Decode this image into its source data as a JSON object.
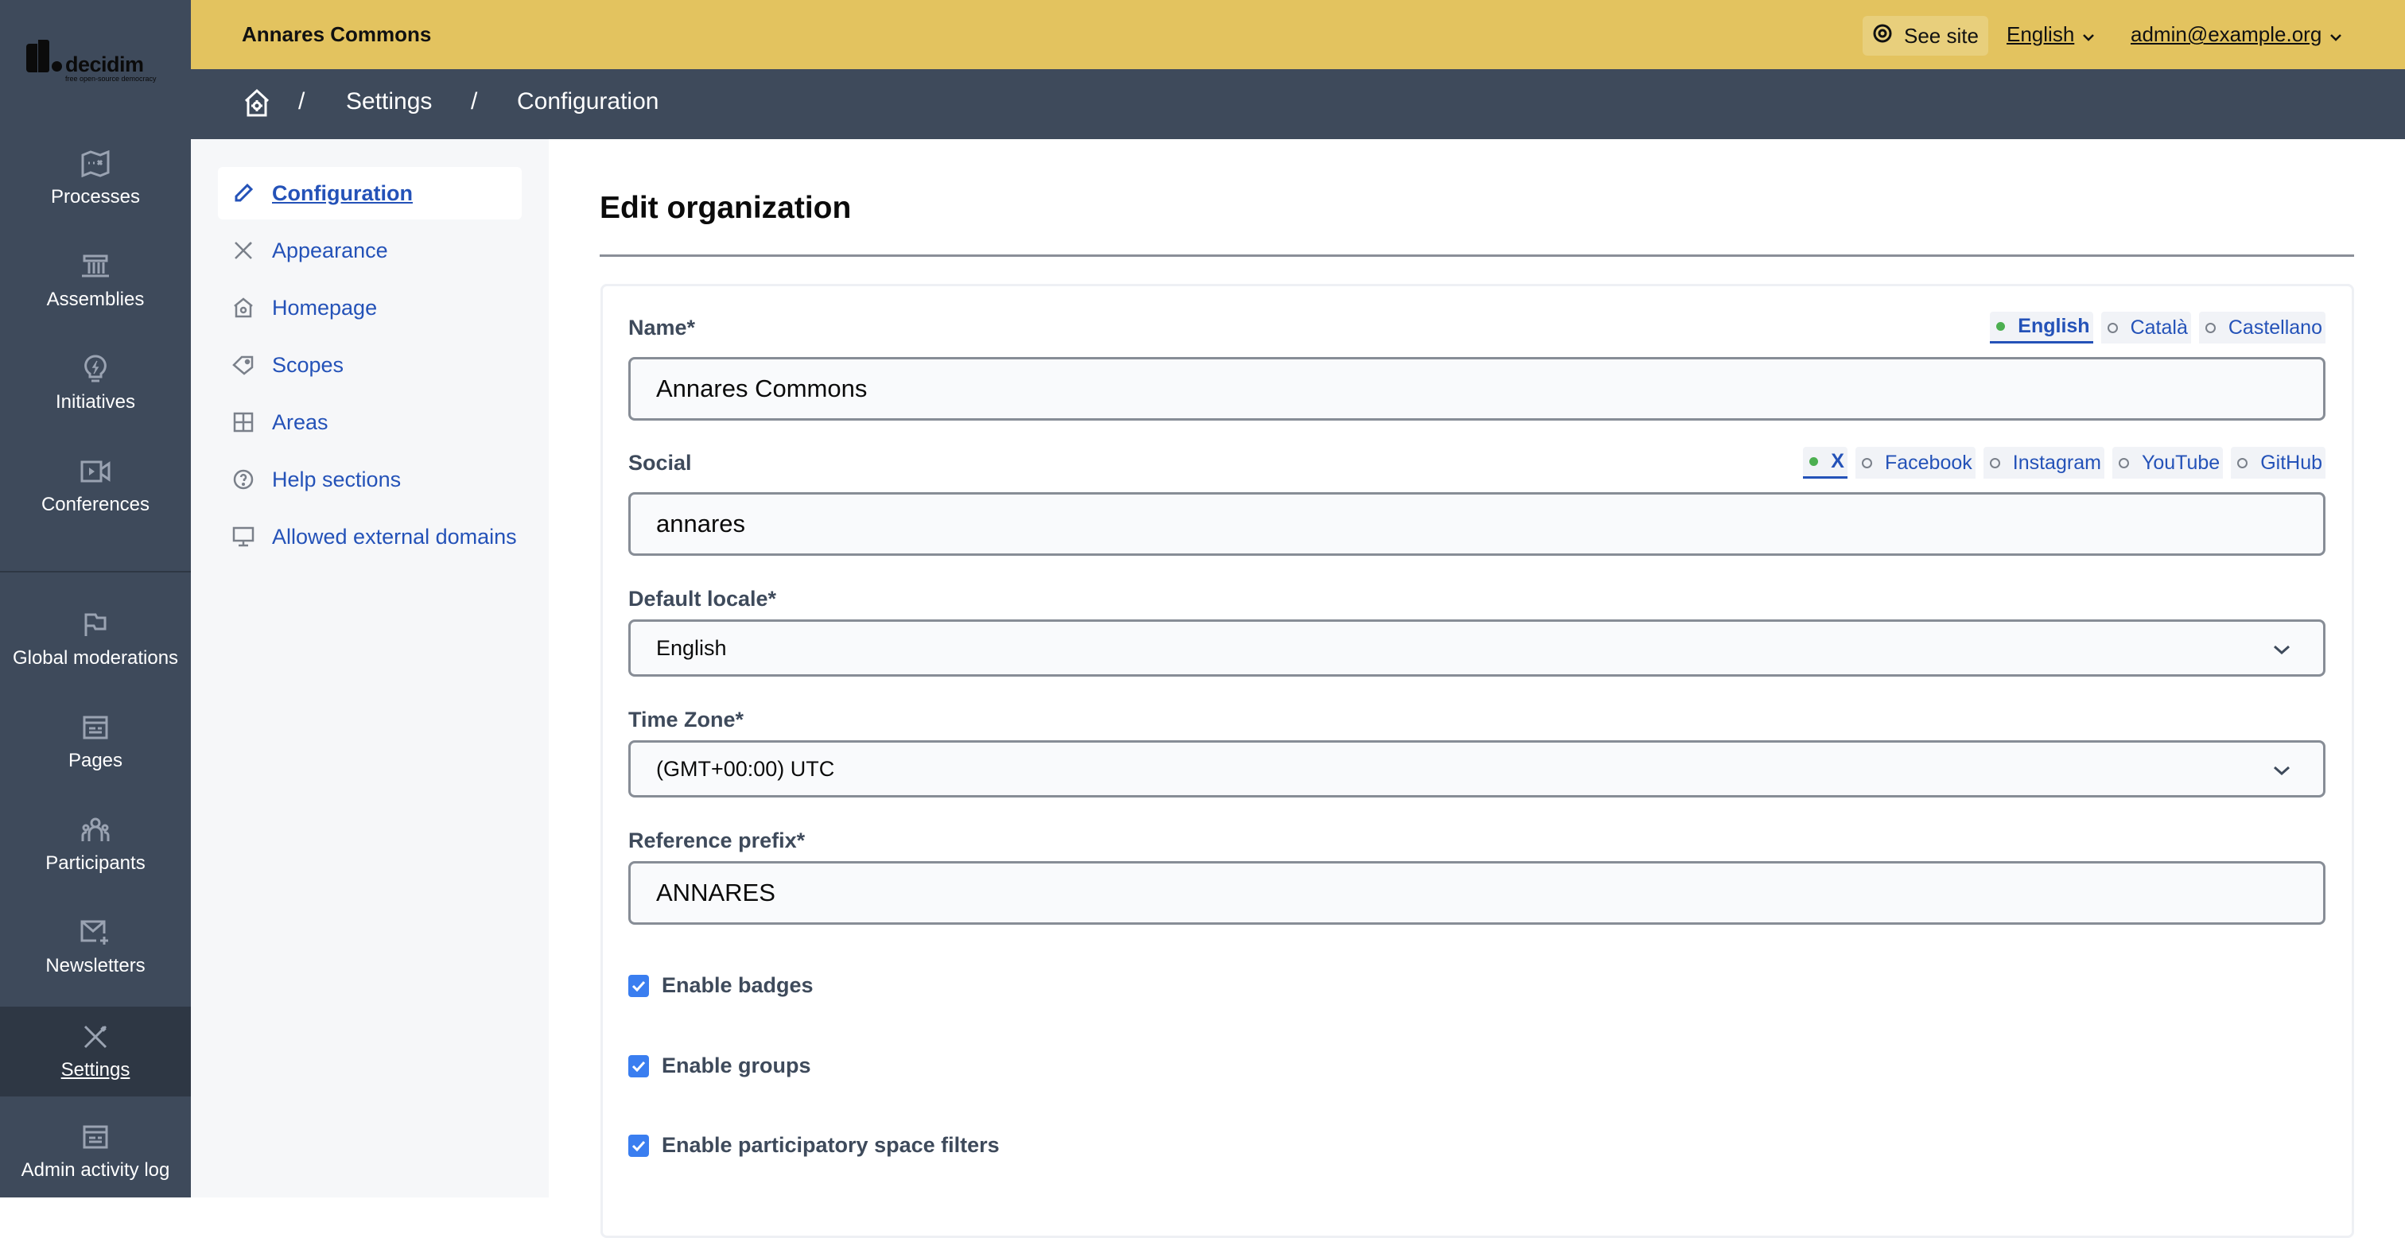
{
  "app": {
    "logo_word": "decidim",
    "logo_tagline": "free open-source democracy",
    "org_name": "Annares Commons"
  },
  "topbar": {
    "see_site": "See site",
    "language": "English",
    "user": "admin@example.org",
    "colors": {
      "topbar_bg": "#e3c35f",
      "sidebar_bg": "#3e4a5b"
    }
  },
  "breadcrumb": {
    "home_icon": "home-gear-icon",
    "separator": "/",
    "items": [
      "Settings",
      "Configuration"
    ]
  },
  "sidebar": {
    "items": [
      {
        "label": "Processes",
        "icon": "map-icon"
      },
      {
        "label": "Assemblies",
        "icon": "government-icon"
      },
      {
        "label": "Initiatives",
        "icon": "lightbulb-flash-icon"
      },
      {
        "label": "Conferences",
        "icon": "video-camera-icon"
      },
      {
        "label": "Global moderations",
        "icon": "flag-icon"
      },
      {
        "label": "Pages",
        "icon": "article-icon"
      },
      {
        "label": "Participants",
        "icon": "group-icon"
      },
      {
        "label": "Newsletters",
        "icon": "mail-add-icon"
      },
      {
        "label": "Settings",
        "icon": "tools-icon",
        "active": true
      },
      {
        "label": "Admin activity log",
        "icon": "article-icon"
      }
    ]
  },
  "subnav": {
    "items": [
      {
        "label": "Configuration",
        "icon": "pencil-icon",
        "active": true
      },
      {
        "label": "Appearance",
        "icon": "tools-icon"
      },
      {
        "label": "Homepage",
        "icon": "home-gear-icon"
      },
      {
        "label": "Scopes",
        "icon": "price-tag-icon"
      },
      {
        "label": "Areas",
        "icon": "layout-grid-icon"
      },
      {
        "label": "Help sections",
        "icon": "question-icon"
      },
      {
        "label": "Allowed external domains",
        "icon": "computer-icon"
      }
    ]
  },
  "main": {
    "title": "Edit organization",
    "name_field": {
      "label": "Name*",
      "value": "Annares Commons",
      "tabs": [
        {
          "label": "English",
          "active": true
        },
        {
          "label": "Català",
          "active": false
        },
        {
          "label": "Castellano",
          "active": false
        }
      ]
    },
    "social_field": {
      "label": "Social",
      "value": "annares",
      "tabs": [
        {
          "label": "X",
          "active": true
        },
        {
          "label": "Facebook",
          "active": false
        },
        {
          "label": "Instagram",
          "active": false
        },
        {
          "label": "YouTube",
          "active": false
        },
        {
          "label": "GitHub",
          "active": false
        }
      ]
    },
    "default_locale": {
      "label": "Default locale*",
      "value": "English"
    },
    "time_zone": {
      "label": "Time Zone*",
      "value": "(GMT+00:00) UTC"
    },
    "reference_prefix": {
      "label": "Reference prefix*",
      "value": "ANNARES"
    },
    "checkboxes": [
      {
        "label": "Enable badges",
        "checked": true
      },
      {
        "label": "Enable groups",
        "checked": true
      },
      {
        "label": "Enable participatory space filters",
        "checked": true
      }
    ]
  }
}
